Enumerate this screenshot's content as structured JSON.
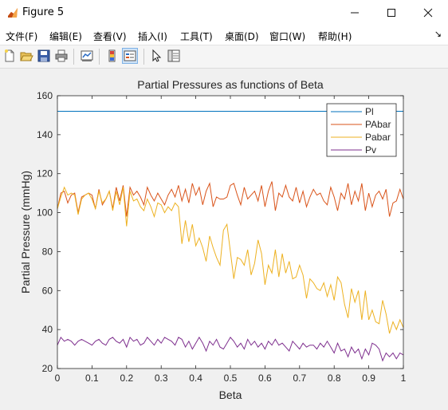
{
  "window": {
    "title": "Figure 5",
    "controls": {
      "minimize": "—",
      "maximize": "☐",
      "close": "✕"
    }
  },
  "menubar": {
    "items": [
      "文件(F)",
      "编辑(E)",
      "查看(V)",
      "插入(I)",
      "工具(T)",
      "桌面(D)",
      "窗口(W)",
      "帮助(H)"
    ],
    "dock_glyph": "↘"
  },
  "toolbar": {
    "icons": [
      "new-figure-icon",
      "open-file-icon",
      "save-icon",
      "print-icon",
      "link-plot-icon",
      "insert-colorbar-icon",
      "insert-legend-icon",
      "edit-plot-icon",
      "property-inspector-icon"
    ]
  },
  "colors": {
    "Pl": "#0072bd",
    "PAbar": "#d95319",
    "Pabar": "#edb120",
    "Pv": "#7e2f8e"
  },
  "chart_data": {
    "type": "line",
    "title": "Partial Pressures as functions of Beta",
    "xlabel": "Beta",
    "ylabel": "Partial Pressure (mmHg)",
    "xlim": [
      0,
      1
    ],
    "ylim": [
      20,
      160
    ],
    "xticks": [
      "0",
      "0.1",
      "0.2",
      "0.3",
      "0.4",
      "0.5",
      "0.6",
      "0.7",
      "0.8",
      "0.9",
      "1"
    ],
    "yticks": [
      "20",
      "40",
      "60",
      "80",
      "100",
      "120",
      "140",
      "160"
    ],
    "grid": false,
    "legend_position": "top-right",
    "x": [
      0,
      0.01,
      0.02,
      0.03,
      0.04,
      0.05,
      0.06,
      0.07,
      0.08,
      0.09,
      0.1,
      0.11,
      0.12,
      0.13,
      0.14,
      0.15,
      0.16,
      0.17,
      0.18,
      0.19,
      0.2,
      0.21,
      0.22,
      0.23,
      0.24,
      0.25,
      0.26,
      0.27,
      0.28,
      0.29,
      0.3,
      0.31,
      0.32,
      0.33,
      0.34,
      0.35,
      0.36,
      0.37,
      0.38,
      0.39,
      0.4,
      0.41,
      0.42,
      0.43,
      0.44,
      0.45,
      0.46,
      0.47,
      0.48,
      0.49,
      0.5,
      0.51,
      0.52,
      0.53,
      0.54,
      0.55,
      0.56,
      0.57,
      0.58,
      0.59,
      0.6,
      0.61,
      0.62,
      0.63,
      0.64,
      0.65,
      0.66,
      0.67,
      0.68,
      0.69,
      0.7,
      0.71,
      0.72,
      0.73,
      0.74,
      0.75,
      0.76,
      0.77,
      0.78,
      0.79,
      0.8,
      0.81,
      0.82,
      0.83,
      0.84,
      0.85,
      0.86,
      0.87,
      0.88,
      0.89,
      0.9,
      0.91,
      0.92,
      0.93,
      0.94,
      0.95,
      0.96,
      0.97,
      0.98,
      0.99,
      1
    ],
    "series": [
      {
        "name": "Pl",
        "values": [
          152,
          152,
          152,
          152,
          152,
          152,
          152,
          152,
          152,
          152,
          152,
          152,
          152,
          152,
          152,
          152,
          152,
          152,
          152,
          152,
          152,
          152,
          152,
          152,
          152,
          152,
          152,
          152,
          152,
          152,
          152,
          152,
          152,
          152,
          152,
          152,
          152,
          152,
          152,
          152,
          152,
          152,
          152,
          152,
          152,
          152,
          152,
          152,
          152,
          152,
          152,
          152,
          152,
          152,
          152,
          152,
          152,
          152,
          152,
          152,
          152,
          152,
          152,
          152,
          152,
          152,
          152,
          152,
          152,
          152,
          152,
          152,
          152,
          152,
          152,
          152,
          152,
          152,
          152,
          152,
          152,
          152,
          152,
          152,
          152,
          152,
          152,
          152,
          152,
          152,
          152,
          152,
          152,
          152,
          152,
          152,
          152,
          152,
          152,
          152,
          152
        ]
      },
      {
        "name": "PAbar",
        "values": [
          102,
          110,
          111,
          105,
          109,
          110,
          100,
          108,
          109,
          110,
          109,
          102,
          112,
          104,
          107,
          111,
          102,
          113,
          106,
          114,
          98,
          113,
          109,
          111,
          108,
          104,
          113,
          109,
          106,
          110,
          107,
          104,
          109,
          112,
          108,
          114,
          106,
          112,
          105,
          115,
          109,
          113,
          104,
          111,
          115,
          103,
          108,
          107,
          107,
          108,
          114,
          115,
          109,
          104,
          113,
          107,
          109,
          111,
          106,
          114,
          103,
          111,
          116,
          101,
          110,
          108,
          114,
          108,
          106,
          113,
          105,
          111,
          103,
          108,
          112,
          109,
          110,
          106,
          104,
          113,
          108,
          101,
          110,
          107,
          115,
          104,
          111,
          106,
          115,
          101,
          110,
          103,
          109,
          111,
          107,
          112,
          98,
          105,
          106,
          112,
          107
        ]
      },
      {
        "name": "Pabar",
        "values": [
          102,
          108,
          113,
          109,
          110,
          109,
          99,
          107,
          109,
          110,
          107,
          102,
          111,
          105,
          107,
          111,
          101,
          111,
          104,
          113,
          93,
          111,
          106,
          107,
          103,
          101,
          107,
          103,
          98,
          105,
          104,
          100,
          103,
          101,
          105,
          103,
          84,
          96,
          85,
          94,
          83,
          87,
          82,
          75,
          88,
          82,
          77,
          73,
          91,
          94,
          80,
          66,
          77,
          76,
          73,
          81,
          68,
          74,
          86,
          79,
          63,
          73,
          69,
          81,
          67,
          79,
          69,
          75,
          66,
          67,
          73,
          68,
          56,
          66,
          64,
          61,
          60,
          64,
          57,
          63,
          55,
          67,
          64,
          53,
          46,
          61,
          54,
          60,
          45,
          60,
          45,
          50,
          44,
          43,
          55,
          48,
          38,
          44,
          40,
          45,
          41
        ]
      },
      {
        "name": "Pv",
        "values": [
          32,
          36,
          34,
          35,
          34,
          32,
          34,
          35,
          34,
          33,
          32,
          34,
          35,
          33,
          32,
          35,
          36,
          34,
          33,
          35,
          31,
          36,
          34,
          35,
          32,
          33,
          36,
          34,
          32,
          35,
          33,
          36,
          35,
          34,
          32,
          36,
          35,
          31,
          34,
          30,
          33,
          36,
          33,
          29,
          34,
          32,
          35,
          31,
          30,
          33,
          36,
          34,
          31,
          33,
          30,
          35,
          32,
          34,
          31,
          33,
          30,
          34,
          32,
          35,
          32,
          33,
          31,
          29,
          34,
          32,
          30,
          33,
          31,
          32,
          32,
          30,
          33,
          31,
          34,
          31,
          28,
          33,
          29,
          30,
          26,
          31,
          28,
          30,
          25,
          30,
          27,
          33,
          32,
          30,
          24,
          28,
          26,
          28,
          25,
          28,
          27
        ]
      }
    ]
  }
}
